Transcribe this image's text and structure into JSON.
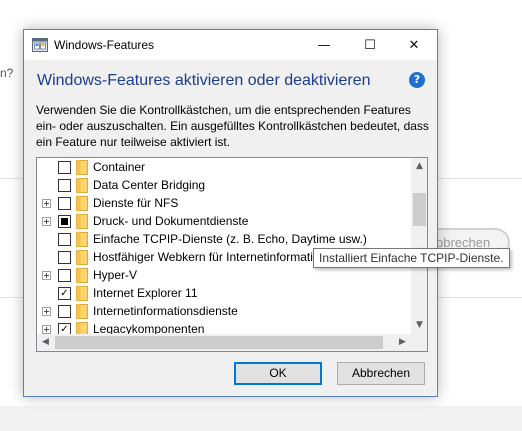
{
  "background": {
    "text_fragment": "n?",
    "button_label": "bbrechen"
  },
  "dialog": {
    "title": "Windows-Features",
    "window_controls": {
      "minimize": "—",
      "maximize": "☐",
      "close": "✕"
    },
    "heading": "Windows-Features aktivieren oder deaktivieren",
    "help_symbol": "?",
    "description": "Verwenden Sie die Kontrollkästchen, um die entsprechenden Features ein- oder auszuschalten. Ein ausgefülltes Kontrollkästchen bedeutet, dass ein Feature nur teilweise aktiviert ist.",
    "features": [
      {
        "label": "Container",
        "state": "unchecked",
        "expandable": false
      },
      {
        "label": "Data Center Bridging",
        "state": "unchecked",
        "expandable": false
      },
      {
        "label": "Dienste für NFS",
        "state": "unchecked",
        "expandable": true
      },
      {
        "label": "Druck- und Dokumentdienste",
        "state": "partial",
        "expandable": true
      },
      {
        "label": "Einfache TCPIP-Dienste (z. B. Echo, Daytime usw.)",
        "state": "unchecked",
        "expandable": false
      },
      {
        "label": "Hostfähiger Webkern für Internetinformationsdienste",
        "state": "unchecked",
        "expandable": false
      },
      {
        "label": "Hyper-V",
        "state": "unchecked",
        "expandable": true
      },
      {
        "label": "Internet Explorer 11",
        "state": "checked",
        "expandable": false
      },
      {
        "label": "Internetinformationsdienste",
        "state": "unchecked",
        "expandable": true
      },
      {
        "label": "Legacykomponenten",
        "state": "checked",
        "expandable": true
      }
    ],
    "scroll_arrows": {
      "up": "▲",
      "down": "▼",
      "left": "◀",
      "right": "▶"
    },
    "tooltip": "Installiert Einfache TCPIP-Dienste.",
    "ok_label": "OK",
    "cancel_label": "Abbrechen"
  },
  "colors": {
    "heading": "#1a3d8f",
    "accent": "#0078d7",
    "folder": "#ffd56a",
    "help_icon": "#1e6fd1"
  },
  "icons": {
    "app": "windows-features-icon",
    "folder": "folder-icon",
    "help": "help-icon",
    "expander": "expand-plus-icon"
  }
}
